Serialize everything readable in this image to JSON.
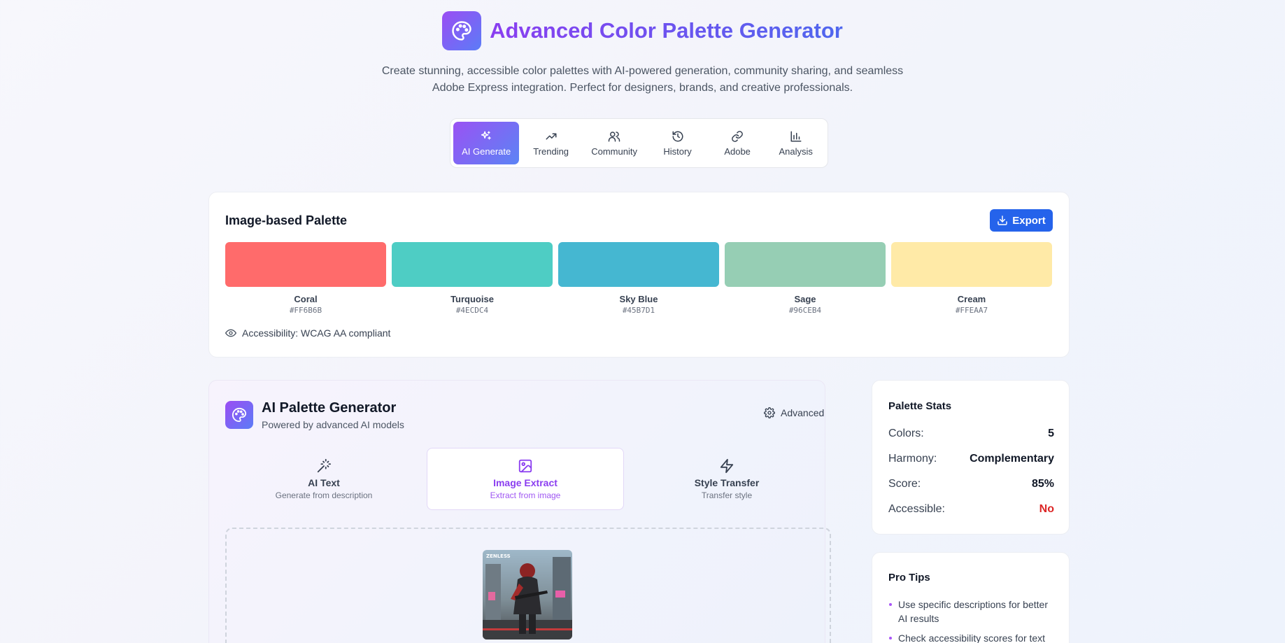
{
  "header": {
    "title": "Advanced Color Palette Generator",
    "subtitle_line1": "Create stunning, accessible color palettes with AI-powered generation, community sharing, and seamless",
    "subtitle_line2": "Adobe Express integration. Perfect for designers, brands, and creative professionals."
  },
  "tabs": [
    {
      "label": "AI Generate",
      "icon": "sparkles-icon",
      "active": true
    },
    {
      "label": "Trending",
      "icon": "trending-up-icon"
    },
    {
      "label": "Community",
      "icon": "users-icon"
    },
    {
      "label": "History",
      "icon": "history-icon"
    },
    {
      "label": "Adobe",
      "icon": "link-icon"
    },
    {
      "label": "Analysis",
      "icon": "bar-chart-icon"
    }
  ],
  "palette": {
    "title": "Image-based Palette",
    "export_label": "Export",
    "swatches": [
      {
        "name": "Coral",
        "hex": "#FF6B6B"
      },
      {
        "name": "Turquoise",
        "hex": "#4ECDC4"
      },
      {
        "name": "Sky Blue",
        "hex": "#45B7D1"
      },
      {
        "name": "Sage",
        "hex": "#96CEB4"
      },
      {
        "name": "Cream",
        "hex": "#FFEAA7"
      }
    ],
    "accessibility": "Accessibility: WCAG AA compliant"
  },
  "generator": {
    "title": "AI Palette Generator",
    "subtitle": "Powered by advanced AI models",
    "advanced_label": "Advanced",
    "modes": [
      {
        "label": "AI Text",
        "desc": "Generate from description",
        "icon": "magic-wand-icon"
      },
      {
        "label": "Image Extract",
        "desc": "Extract from image",
        "icon": "image-icon",
        "active": true
      },
      {
        "label": "Style Transfer",
        "desc": "Transfer style",
        "icon": "lightning-icon"
      }
    ],
    "thumbnail_logo": "ZENLESS"
  },
  "stats": {
    "title": "Palette Stats",
    "rows": [
      {
        "label": "Colors:",
        "value": "5"
      },
      {
        "label": "Harmony:",
        "value": "Complementary"
      },
      {
        "label": "Score:",
        "value": "85%"
      },
      {
        "label": "Accessible:",
        "value": "No"
      }
    ]
  },
  "tips": {
    "title": "Pro Tips",
    "items": [
      "Use specific descriptions for better AI results",
      "Check accessibility scores for text"
    ]
  },
  "colors": {
    "accent_purple": "#8b3ef0",
    "accent_blue": "#2563eb",
    "negative": "#dc2626"
  }
}
